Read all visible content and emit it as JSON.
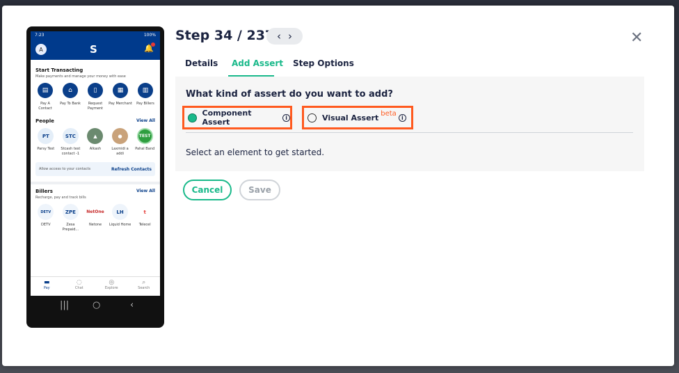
{
  "header": {
    "step_title": "Step 34 / 237",
    "prev_glyph": "‹",
    "next_glyph": "›",
    "close_glyph": "✕"
  },
  "tabs": [
    {
      "label": "Details"
    },
    {
      "label": "Add Assert"
    },
    {
      "label": "Step Options"
    }
  ],
  "active_tab": "Add Assert",
  "assert_panel": {
    "question": "What kind of assert do you want to add?",
    "options": [
      {
        "label": "Component Assert",
        "selected": true
      },
      {
        "label": "Visual Assert",
        "badge": "beta",
        "selected": false
      }
    ],
    "info_glyph": "i",
    "hint": "Select an element to get started."
  },
  "actions": {
    "cancel_label": "Cancel",
    "save_label": "Save"
  },
  "colors": {
    "accent": "#19b98a",
    "highlight_border": "#ff5a1f",
    "title_text": "#1b2340",
    "phone_brand": "#003a8c"
  },
  "phone": {
    "status_time": "7:23",
    "status_battery": "100%",
    "avatar_letter": "A",
    "start_transacting": {
      "title": "Start Transacting",
      "subtitle": "Make payments and manage your money with ease",
      "actions": [
        {
          "label": "Pay A Contact",
          "icon": "contact-icon"
        },
        {
          "label": "Pay To Bank",
          "icon": "bank-icon"
        },
        {
          "label": "Request Payment",
          "icon": "request-icon"
        },
        {
          "label": "Pay Merchant",
          "icon": "merchant-icon"
        },
        {
          "label": "Pay Billers",
          "icon": "bill-icon"
        }
      ]
    },
    "people": {
      "title": "People",
      "view_all": "View All",
      "items": [
        {
          "initials": "PT",
          "name": "Parsy Test"
        },
        {
          "initials": "STC",
          "name": "Stcash test contact -1"
        },
        {
          "initials": "",
          "name": "Alkash"
        },
        {
          "initials": "",
          "name": "Laxmidi a addi"
        },
        {
          "initials": "TEST",
          "name": "Pahal Band"
        }
      ]
    },
    "refresh": {
      "text": "Allow access to your contacts",
      "action": "Refresh Contacts"
    },
    "billers": {
      "title": "Billers",
      "subtitle": "Recharge, pay and track bills",
      "view_all": "View All",
      "items": [
        {
          "mark": "DETV",
          "name": "DETV"
        },
        {
          "mark": "ZPE",
          "name": "Zesa Prepaid..."
        },
        {
          "mark": "NetOne",
          "name": "Netone"
        },
        {
          "mark": "LH",
          "name": "Liquid Home"
        },
        {
          "mark": "t",
          "name": "Telecel"
        }
      ]
    },
    "tabbar": [
      {
        "label": "Pay",
        "icon": "wallet-icon"
      },
      {
        "label": "Chat",
        "icon": "chat-icon"
      },
      {
        "label": "Explore",
        "icon": "compass-icon"
      },
      {
        "label": "Search",
        "icon": "search-icon"
      }
    ]
  }
}
